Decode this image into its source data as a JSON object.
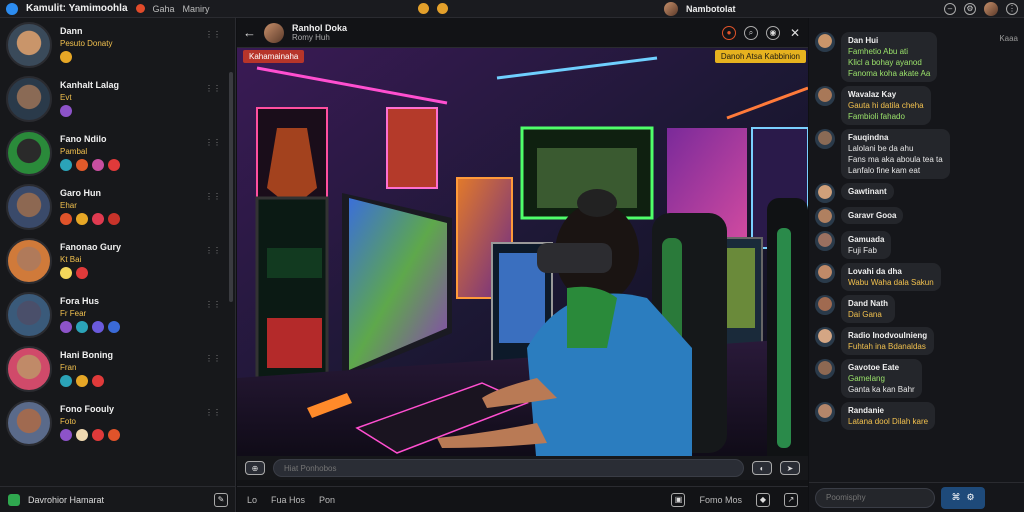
{
  "app": {
    "title": "Kamulit: Yamimoohla",
    "menu": [
      "Gaha",
      "Maniry"
    ],
    "user": "Nambotolat"
  },
  "sidebar": {
    "footer_label": "Davrohior Hamarat",
    "contacts": [
      {
        "name": "Dann",
        "status": "Pesuto Donaty",
        "emojis": [
          "#e7a726"
        ]
      },
      {
        "name": "Kanhalt Lalag",
        "status": "Evt",
        "emojis": [
          "#8d53c9"
        ]
      },
      {
        "name": "Fano Ndilo",
        "status": "Pambal",
        "emojis": [
          "#2ba3b8",
          "#e05a2a",
          "#c84fa0",
          "#e03a3a"
        ]
      },
      {
        "name": "Garo Hun",
        "status": "Ehar",
        "emojis": [
          "#e0532a",
          "#e7a726",
          "#e03a50",
          "#c8332a"
        ]
      },
      {
        "name": "Fanonao Gury",
        "status": "Kt Bai",
        "emojis": [
          "#f3d65a",
          "#e03a3a"
        ]
      },
      {
        "name": "Fora Hus",
        "status": "Fr Fear",
        "emojis": [
          "#8d53c9",
          "#2ba3b8",
          "#6a5adc",
          "#3a6ad8"
        ]
      },
      {
        "name": "Hani Boning",
        "status": "Fran",
        "emojis": [
          "#2ba3b8",
          "#e7a726",
          "#e03a3a"
        ]
      },
      {
        "name": "Fono Foouly",
        "status": "Foto",
        "emojis": [
          "#8d53c9",
          "#f0d9b0",
          "#e03a3a",
          "#e0532a"
        ]
      }
    ]
  },
  "chat": {
    "title": "Ranhol Doka",
    "subtitle": "Romy Huh",
    "live_badge": "Kahamainaha",
    "info_badge": "Danoh Atsa Kabbinion",
    "input_placeholder": "Hiat Ponhobos",
    "footer_items": [
      "Lo",
      "Fua Hos",
      "Pon"
    ],
    "footer_right": "Fomo Mos"
  },
  "messages": {
    "time": "Kaaa",
    "input_placeholder": "Poomisphy",
    "items": [
      {
        "who": "Dan Hui",
        "lines": [
          {
            "t": "Famhetio Abu ati",
            "c": "g"
          },
          {
            "t": "Klicl a bohay ayanod",
            "c": "g"
          },
          {
            "t": "Fanoma koha akate Aa",
            "c": "g"
          }
        ],
        "face": "#c9956a"
      },
      {
        "who": "Wavalaz Kay",
        "lines": [
          {
            "t": "Gauta hi datila cheha",
            "c": "y"
          },
          {
            "t": "Fambioli fahado",
            "c": "g"
          }
        ],
        "face": "#a87858"
      },
      {
        "who": "Fauqindna",
        "lines": [
          {
            "t": "Lalolani be da ahu",
            "c": "w"
          },
          {
            "t": "Fans ma aka aboula tea ta",
            "c": "w"
          },
          {
            "t": "Lanfalo fine kam eat",
            "c": "w"
          }
        ],
        "face": "#8a6a55"
      },
      {
        "who": "Gawtinant",
        "lines": [],
        "face": "#d0a07a"
      },
      {
        "who": "Garavr Gooa",
        "lines": [],
        "face": "#b08060"
      },
      {
        "who": "Gamuada",
        "lines": [
          {
            "t": "Fuji Fab",
            "c": "w"
          }
        ],
        "face": "#9a7060"
      },
      {
        "who": "Lovahi da dha",
        "lines": [
          {
            "t": "Wabu Waha dala Sakun",
            "c": "y"
          }
        ],
        "face": "#c08a68"
      },
      {
        "who": "Dand Nath",
        "lines": [
          {
            "t": "Dai Gana",
            "c": "y"
          }
        ],
        "face": "#a06a50"
      },
      {
        "who": "Radio Inodvoulnieng",
        "lines": [
          {
            "t": "Fuhtah ina Bdanaldas",
            "c": "y"
          }
        ],
        "face": "#d4a684"
      },
      {
        "who": "Gavotoe Eate",
        "lines": [
          {
            "t": "Gamelang",
            "c": "g"
          },
          {
            "t": "Ganta ka kan Bahr",
            "c": "w"
          }
        ],
        "face": "#8d6852"
      },
      {
        "who": "Randanie",
        "lines": [
          {
            "t": "Latana dool Dilah kare",
            "c": "y"
          }
        ],
        "face": "#b4866a"
      }
    ]
  }
}
